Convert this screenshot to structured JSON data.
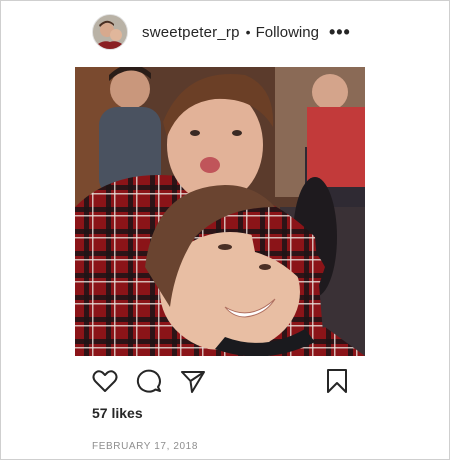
{
  "post": {
    "username": "sweetpeter_rp",
    "separator": "•",
    "follow_label": "Following",
    "more_label": "•••",
    "likes": "57 likes",
    "date": "FEBRUARY 17, 2018"
  },
  "icons": {
    "like": "heart-icon",
    "comment": "comment-icon",
    "share": "paper-plane-icon",
    "save": "bookmark-icon",
    "more": "more-options-icon"
  },
  "colors": {
    "text": "#262626",
    "secondary": "#8e8e8e",
    "border": "#cfcfcf"
  }
}
